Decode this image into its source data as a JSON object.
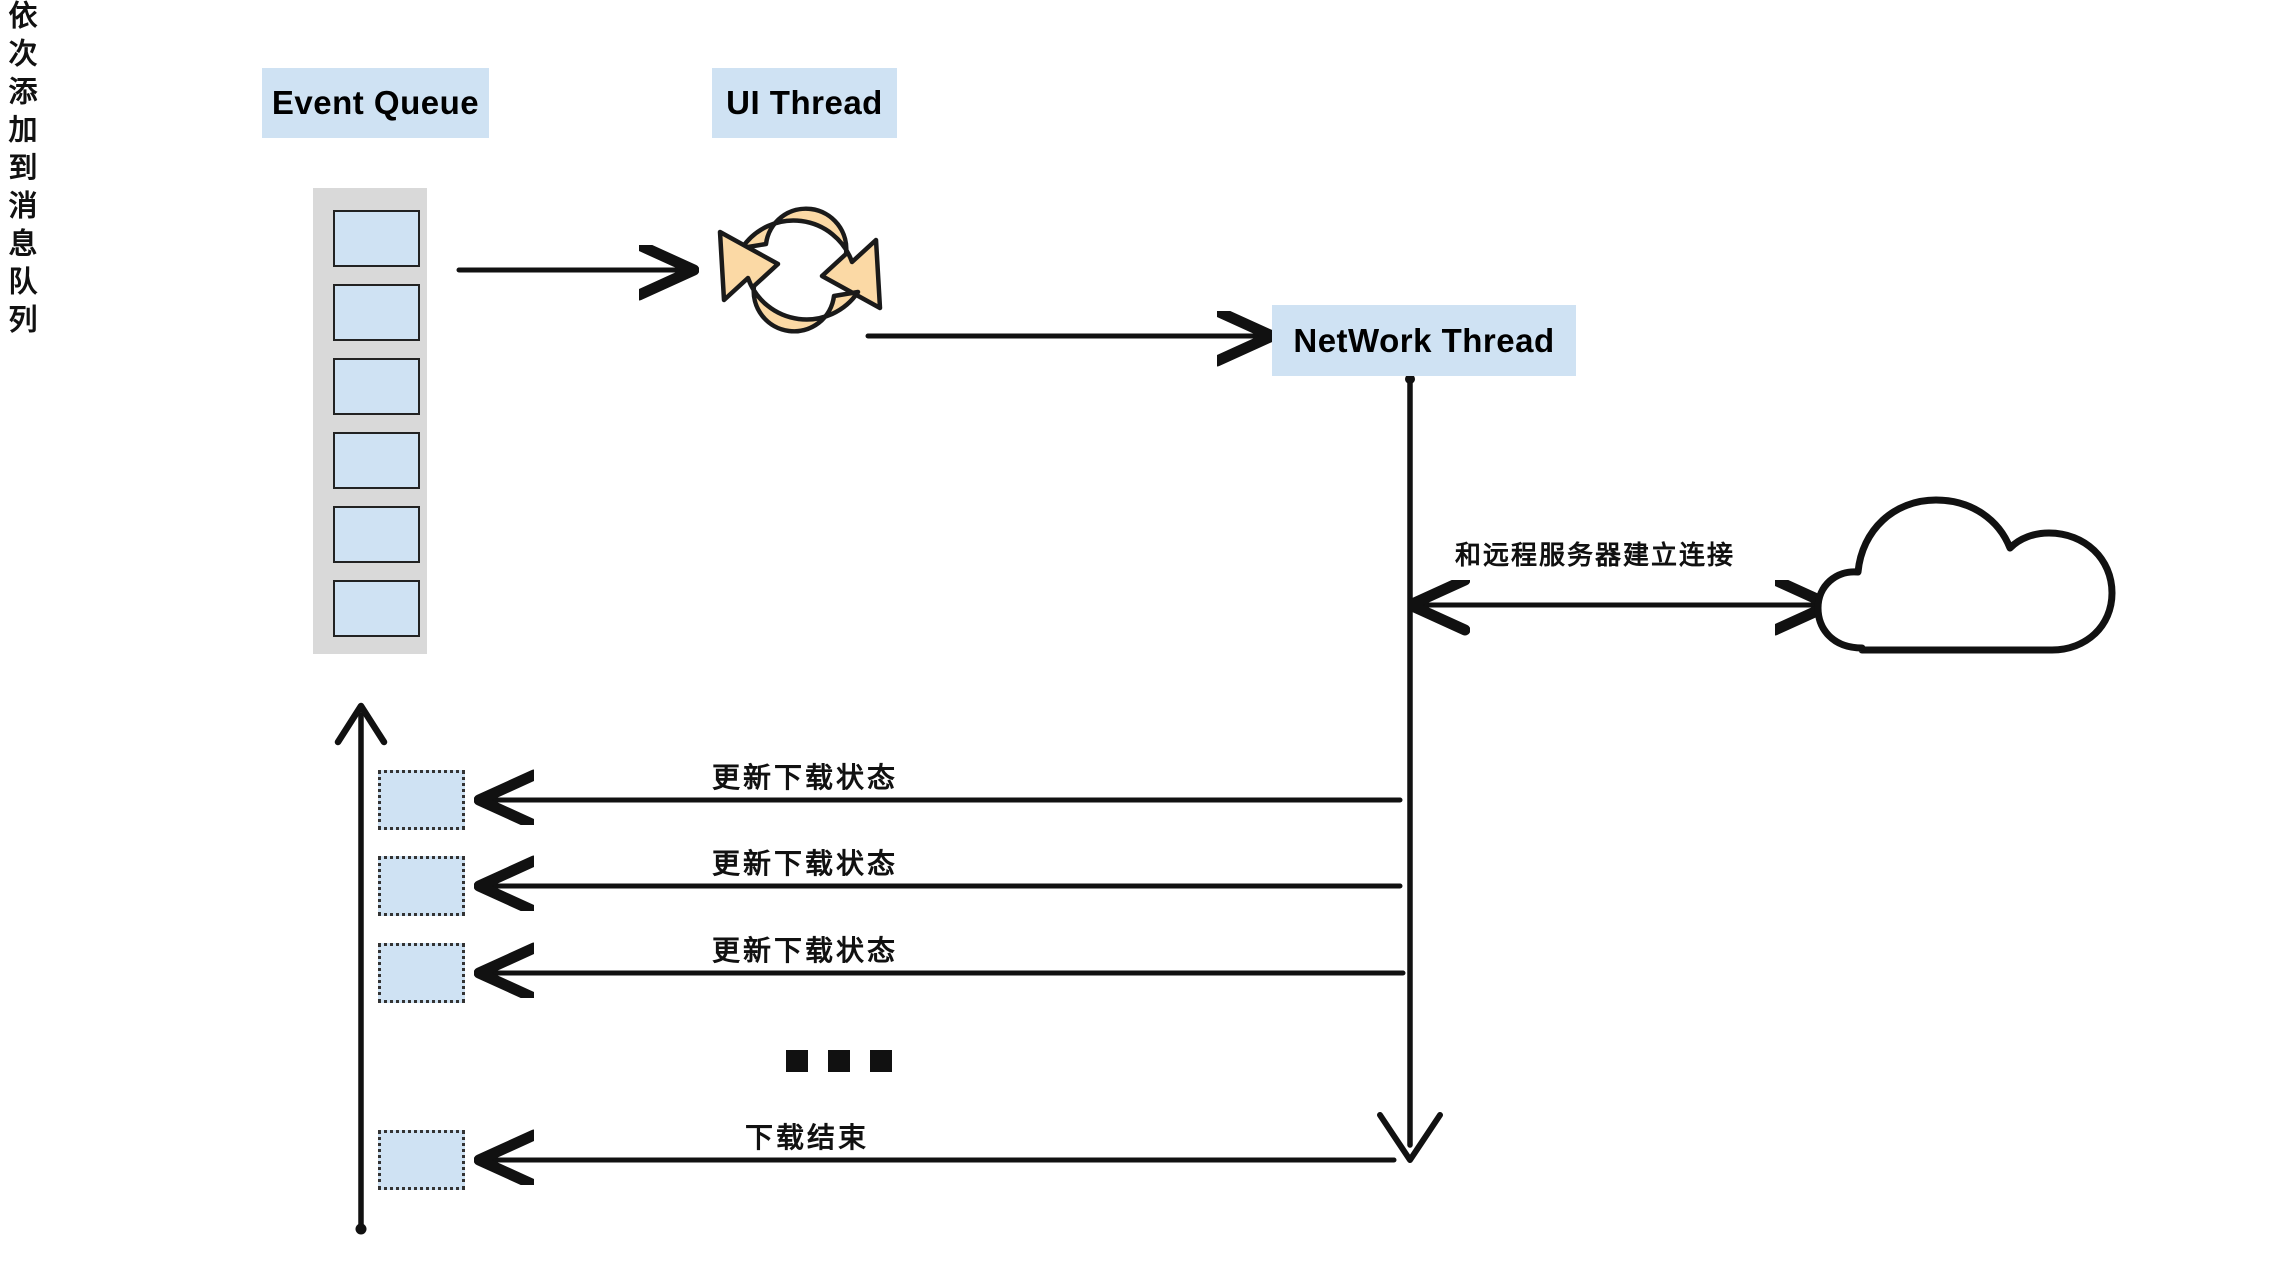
{
  "diagram": {
    "title": "Android download threading model diagram",
    "background": "#ffffff",
    "colors": {
      "chip_fill": "#cfe2f3",
      "queue_container_fill": "#d9d9d9",
      "cell_fill": "#cfe2f3",
      "cell_border": "#222222",
      "ink": "#111111",
      "loop_icon_fill": "#fbd9a5"
    }
  },
  "chips": {
    "event_queue": "Event Queue",
    "ui_thread": "UI Thread",
    "network_thread": "NetWork Thread"
  },
  "queue": {
    "cell_count": 6,
    "cells": [
      "",
      "",
      "",
      "",
      "",
      ""
    ]
  },
  "icons": {
    "loop": "refresh-loop-icon",
    "cloud": "cloud-icon",
    "arrow_right": "arrow-right-icon",
    "arrow_left": "arrow-left-icon",
    "arrow_up": "arrow-up-icon",
    "arrow_down": "arrow-down-icon",
    "arrow_double": "arrow-double-horizontal-icon",
    "ellipsis": "ellipsis-squares-icon"
  },
  "labels": {
    "connect_remote_server": "和远程服务器建立连接",
    "enqueue_vertical": "依次添加到消息队列",
    "ellipsis": "..."
  },
  "messages": [
    {
      "text": "更新下载状态"
    },
    {
      "text": "更新下载状态"
    },
    {
      "text": "更新下载状态"
    },
    {
      "text": "下载结束"
    }
  ]
}
